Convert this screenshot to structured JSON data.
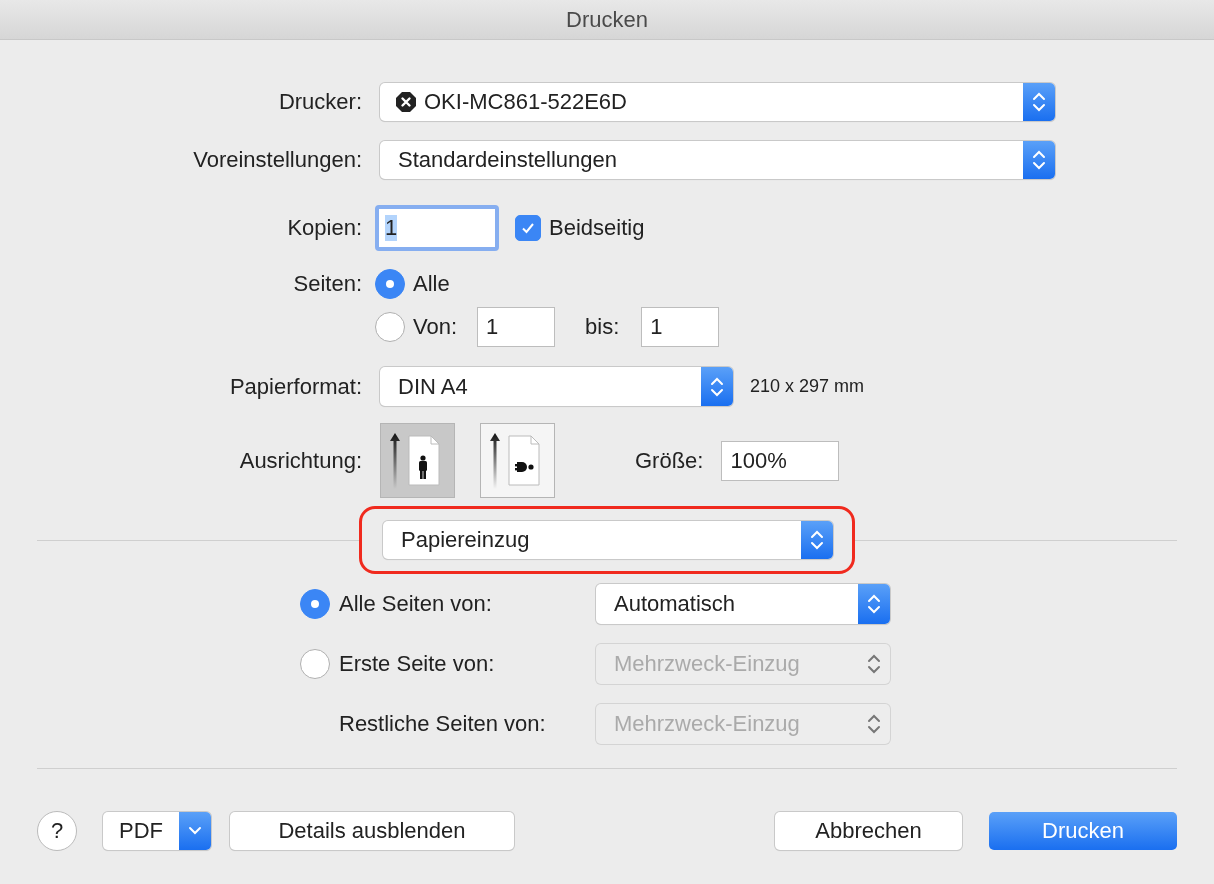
{
  "window": {
    "title": "Drucken"
  },
  "printer": {
    "label": "Drucker:",
    "value": "OKI-MC861-522E6D"
  },
  "presets": {
    "label": "Voreinstellungen:",
    "value": "Standardeinstellungen"
  },
  "copies": {
    "label": "Kopien:",
    "value": "1",
    "focused": true
  },
  "two_sided": {
    "label": "Beidseitig",
    "checked": true
  },
  "pages": {
    "label": "Seiten:",
    "options": [
      {
        "label": "Alle",
        "selected": true
      },
      {
        "label": "Von:",
        "selected": false
      }
    ],
    "from": "1",
    "to_label": "bis:",
    "to": "1"
  },
  "paper_size": {
    "label": "Papierformat:",
    "value": "DIN A4",
    "dimensions": "210 x 297 mm"
  },
  "orientation": {
    "label": "Ausrichtung:",
    "options": [
      {
        "kind": "portrait",
        "selected": true
      },
      {
        "kind": "landscape",
        "selected": false
      }
    ]
  },
  "scale": {
    "label": "Größe:",
    "value": "100%"
  },
  "section": {
    "value": "Papiereinzug",
    "highlighted": true
  },
  "paper_feed": [
    {
      "kind": "radio",
      "label": "Alle Seiten von:",
      "selected": true,
      "value": "Automatisch",
      "disabled": false
    },
    {
      "kind": "radio",
      "label": "Erste Seite von:",
      "selected": false,
      "value": "Mehrzweck-Einzug",
      "disabled": true
    },
    {
      "kind": "plain",
      "label": "Restliche Seiten von:",
      "value": "Mehrzweck-Einzug",
      "disabled": true
    }
  ],
  "buttons": {
    "help": "?",
    "pdf": "PDF",
    "details": "Details ausblenden",
    "cancel": "Abbrechen",
    "print": "Drucken"
  }
}
